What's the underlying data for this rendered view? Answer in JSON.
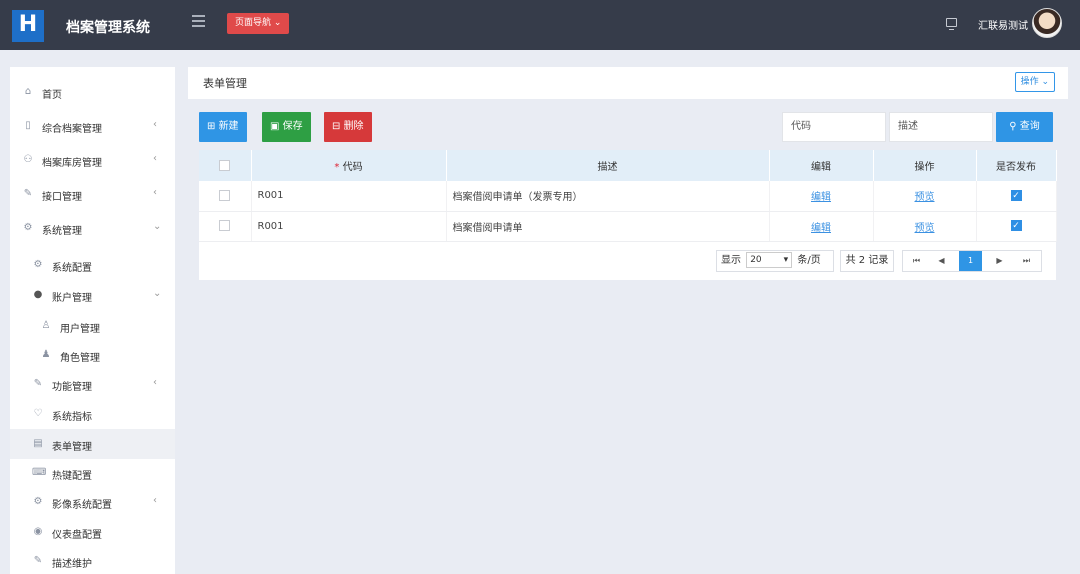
{
  "app": {
    "title": "档案管理系统",
    "logo_text": "H"
  },
  "topbar": {
    "nav_button": "页面导航 ⌄",
    "user_name": "汇联易测试"
  },
  "sidebar": {
    "items": [
      {
        "label": "首页",
        "icon": "home-icon",
        "arrow": ""
      },
      {
        "label": "综合档案管理",
        "icon": "file-icon",
        "arrow": "‹"
      },
      {
        "label": "档案库房管理",
        "icon": "warehouse-icon",
        "arrow": "‹"
      },
      {
        "label": "接口管理",
        "icon": "plug-icon",
        "arrow": "‹"
      },
      {
        "label": "系统管理",
        "icon": "gear-icon",
        "arrow": "⌄"
      },
      {
        "label": "系统配置",
        "icon": "cog-icon",
        "arrow": ""
      },
      {
        "label": "账户管理",
        "icon": "user-icon",
        "arrow": "⌄"
      },
      {
        "label": "用户管理",
        "icon": "user-add-icon",
        "arrow": ""
      },
      {
        "label": "角色管理",
        "icon": "group-icon",
        "arrow": ""
      },
      {
        "label": "功能管理",
        "icon": "plug-icon",
        "arrow": "‹"
      },
      {
        "label": "系统指标",
        "icon": "heart-icon",
        "arrow": ""
      },
      {
        "label": "表单管理",
        "icon": "form-icon",
        "arrow": ""
      },
      {
        "label": "热键配置",
        "icon": "keyboard-icon",
        "arrow": ""
      },
      {
        "label": "影像系统配置",
        "icon": "gears-icon",
        "arrow": "‹"
      },
      {
        "label": "仪表盘配置",
        "icon": "dashboard-icon",
        "arrow": ""
      },
      {
        "label": "描述维护",
        "icon": "edit-icon",
        "arrow": ""
      }
    ]
  },
  "header": {
    "title": "表单管理",
    "operation_button": "操作 ⌄"
  },
  "toolbar": {
    "new_label": "新建",
    "save_label": "保存",
    "delete_label": "删除",
    "search_code_placeholder": "代码",
    "search_desc_placeholder": "描述",
    "query_label": "查询"
  },
  "table": {
    "headers": {
      "code": "代码",
      "desc": "描述",
      "edit": "编辑",
      "operation": "操作",
      "published": "是否发布"
    },
    "required_mark": "*",
    "rows": [
      {
        "code": "R001",
        "desc": "档案借阅申请单（发票专用）",
        "edit": "编辑",
        "operation": "预览",
        "published": true
      },
      {
        "code": "R001",
        "desc": "档案借阅申请单",
        "edit": "编辑",
        "operation": "预览",
        "published": true
      }
    ]
  },
  "pagination": {
    "show_label": "显示",
    "page_size": "20",
    "per_page_label": "条/页",
    "total_label": "共 2 记录",
    "current_page": "1"
  },
  "colors": {
    "primary": "#2f95e5",
    "save": "#2e9f44",
    "danger": "#d6393a",
    "topbar": "#363c4a"
  }
}
